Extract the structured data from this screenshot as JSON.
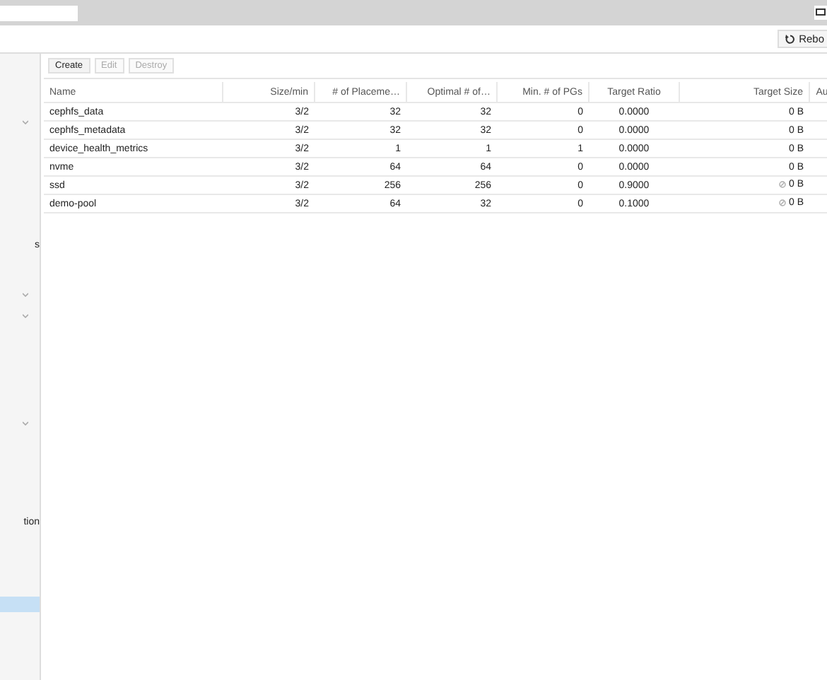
{
  "toolbar": {
    "reboot_label": "Rebo"
  },
  "sidebar": {
    "items": [
      {
        "label": "s",
        "selected": false
      },
      {
        "label": "tion",
        "selected": false
      },
      {
        "selected": true
      }
    ]
  },
  "pool_toolbar": {
    "buttons": [
      {
        "label": "Create",
        "disabled": false
      },
      {
        "label": "Edit",
        "disabled": true
      },
      {
        "label": "Destroy",
        "disabled": true
      }
    ]
  },
  "table": {
    "columns": [
      "Name",
      "Size/min",
      "# of Placeme…",
      "Optimal # of…",
      "Min. # of PGs",
      "Target Ratio",
      "Target Size",
      "Au"
    ],
    "rows": [
      {
        "cells": [
          "cephfs_data",
          "3/2",
          "32",
          "32",
          "0",
          "0.0000",
          "0 B"
        ],
        "size_icon": false
      },
      {
        "cells": [
          "cephfs_metadata",
          "3/2",
          "32",
          "32",
          "0",
          "0.0000",
          "0 B"
        ],
        "size_icon": false
      },
      {
        "cells": [
          "device_health_metrics",
          "3/2",
          "1",
          "1",
          "1",
          "0.0000",
          "0 B"
        ],
        "size_icon": false
      },
      {
        "cells": [
          "nvme",
          "3/2",
          "64",
          "64",
          "0",
          "0.0000",
          "0 B"
        ],
        "size_icon": false
      },
      {
        "cells": [
          "ssd",
          "3/2",
          "256",
          "256",
          "0",
          "0.9000",
          "0 B"
        ],
        "size_icon": true
      },
      {
        "cells": [
          "demo-pool",
          "3/2",
          "64",
          "32",
          "0",
          "0.1000",
          "0 B"
        ],
        "size_icon": true
      }
    ]
  }
}
